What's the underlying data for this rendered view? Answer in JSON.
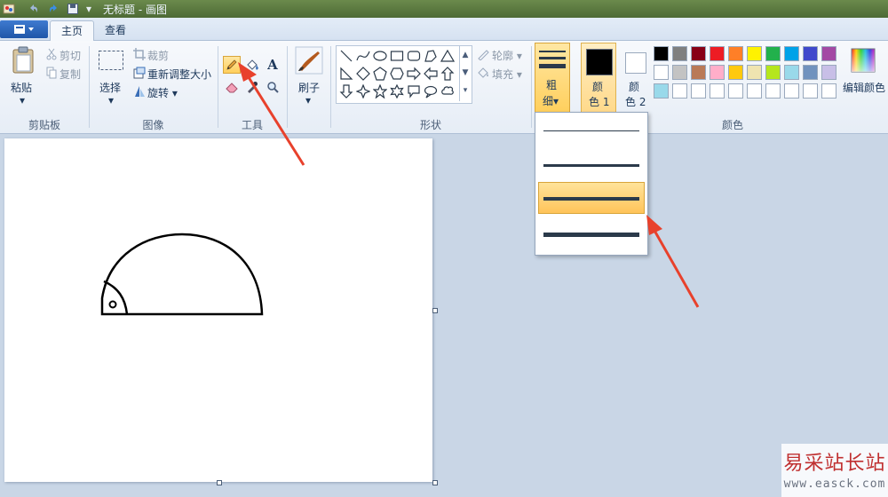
{
  "window": {
    "title": "无标题 - 画图",
    "quick_access": [
      "undo-icon",
      "redo-icon",
      "save-icon",
      "customize-icon"
    ]
  },
  "tabs": {
    "app_menu_icon": "app-menu-icon",
    "home": "主页",
    "view": "查看"
  },
  "ribbon": {
    "clipboard": {
      "paste": "粘贴",
      "cut": "剪切",
      "copy": "复制",
      "group": "剪贴板"
    },
    "image": {
      "select": "选择",
      "crop": "裁剪",
      "resize": "重新调整大小",
      "rotate": "旋转",
      "group": "图像"
    },
    "tools": {
      "group": "工具",
      "active_tool": "pencil"
    },
    "brushes": {
      "label": "刷子"
    },
    "shapes": {
      "group": "形状",
      "outline": "轮廓",
      "fill": "填充"
    },
    "size": {
      "label_1": "粗",
      "label_2": "细"
    },
    "colors": {
      "color1_a": "颜",
      "color1_b": "色 1",
      "color2_a": "颜",
      "color2_b": "色 2",
      "edit_colors": "编辑颜色",
      "group": "颜色",
      "color1_value": "#000000",
      "color2_value": "#ffffff",
      "palette_row1": [
        "#000000",
        "#7f7f7f",
        "#880015",
        "#ed1c24",
        "#ff7f27",
        "#fff200",
        "#22b14c",
        "#00a2e8",
        "#3f48cc",
        "#a349a4"
      ],
      "palette_row2": [
        "#ffffff",
        "#c3c3c3",
        "#b97a57",
        "#ffaec9",
        "#ffc90e",
        "#efe4b0",
        "#b5e61d",
        "#99d9ea",
        "#7092be",
        "#c8bfe7"
      ],
      "palette_row3": [
        "#99d9ea",
        "#ffffff",
        "#ffffff",
        "#ffffff",
        "#ffffff",
        "#ffffff",
        "#ffffff",
        "#ffffff",
        "#ffffff",
        "#ffffff"
      ]
    }
  },
  "size_dropdown": {
    "options": [
      "1px",
      "3px",
      "5px",
      "8px"
    ],
    "selected_index": 2
  },
  "watermark": {
    "title": "易采站长站",
    "url": "www.easck.com"
  }
}
